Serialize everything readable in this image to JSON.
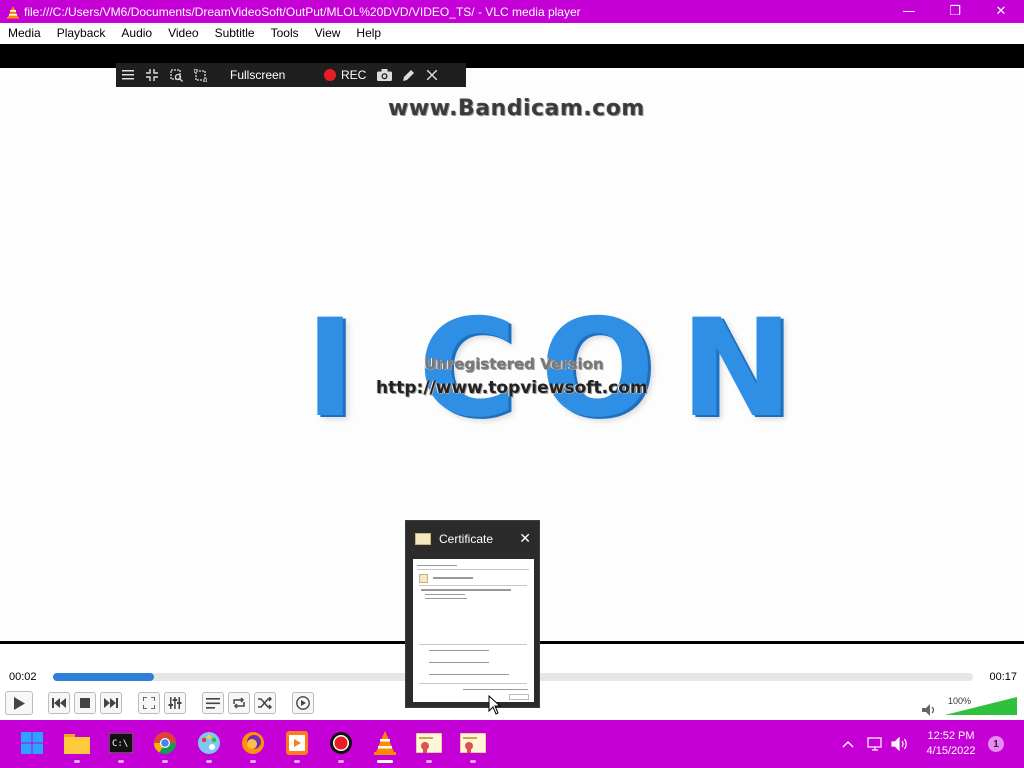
{
  "window": {
    "title": "file:///C:/Users/VM6/Documents/DreamVideoSoft/OutPut/MLOL%20DVD/VIDEO_TS/ - VLC media player",
    "minimize_glyph": "—",
    "restore_glyph": "❐",
    "close_glyph": "✕"
  },
  "menu": [
    "Media",
    "Playback",
    "Audio",
    "Video",
    "Subtitle",
    "Tools",
    "View",
    "Help"
  ],
  "bandicam": {
    "fullscreen_label": "Fullscreen",
    "rec_label": "REC"
  },
  "video": {
    "watermark_top": "www.Bandicam.com",
    "watermark_unregistered": "Unregistered Version",
    "watermark_url": "http://www.topviewsoft.com",
    "letters": [
      "I",
      "C",
      "O",
      "N"
    ]
  },
  "playback": {
    "time_current": "00:02",
    "time_total": "00:17",
    "progress_fraction": 0.11,
    "volume_label": "100%",
    "volume_fraction": 1.0
  },
  "certificate_thumbnail": {
    "title": "Certificate"
  },
  "taskbar": {
    "apps": [
      "start",
      "file-explorer",
      "terminal",
      "chrome",
      "paint",
      "firefox",
      "video-editor",
      "bandicam",
      "vlc",
      "certificate-1",
      "certificate-2"
    ],
    "active_app": "vlc",
    "clock_time": "12:52 PM",
    "clock_date": "4/15/2022",
    "notification_count": "1"
  },
  "colors": {
    "accent_magenta": "#c400d6",
    "progress_blue": "#2f7fd6",
    "icon_blue": "#2e8fe5",
    "rec_red": "#e81d25",
    "volume_green": "#2fc13e"
  }
}
